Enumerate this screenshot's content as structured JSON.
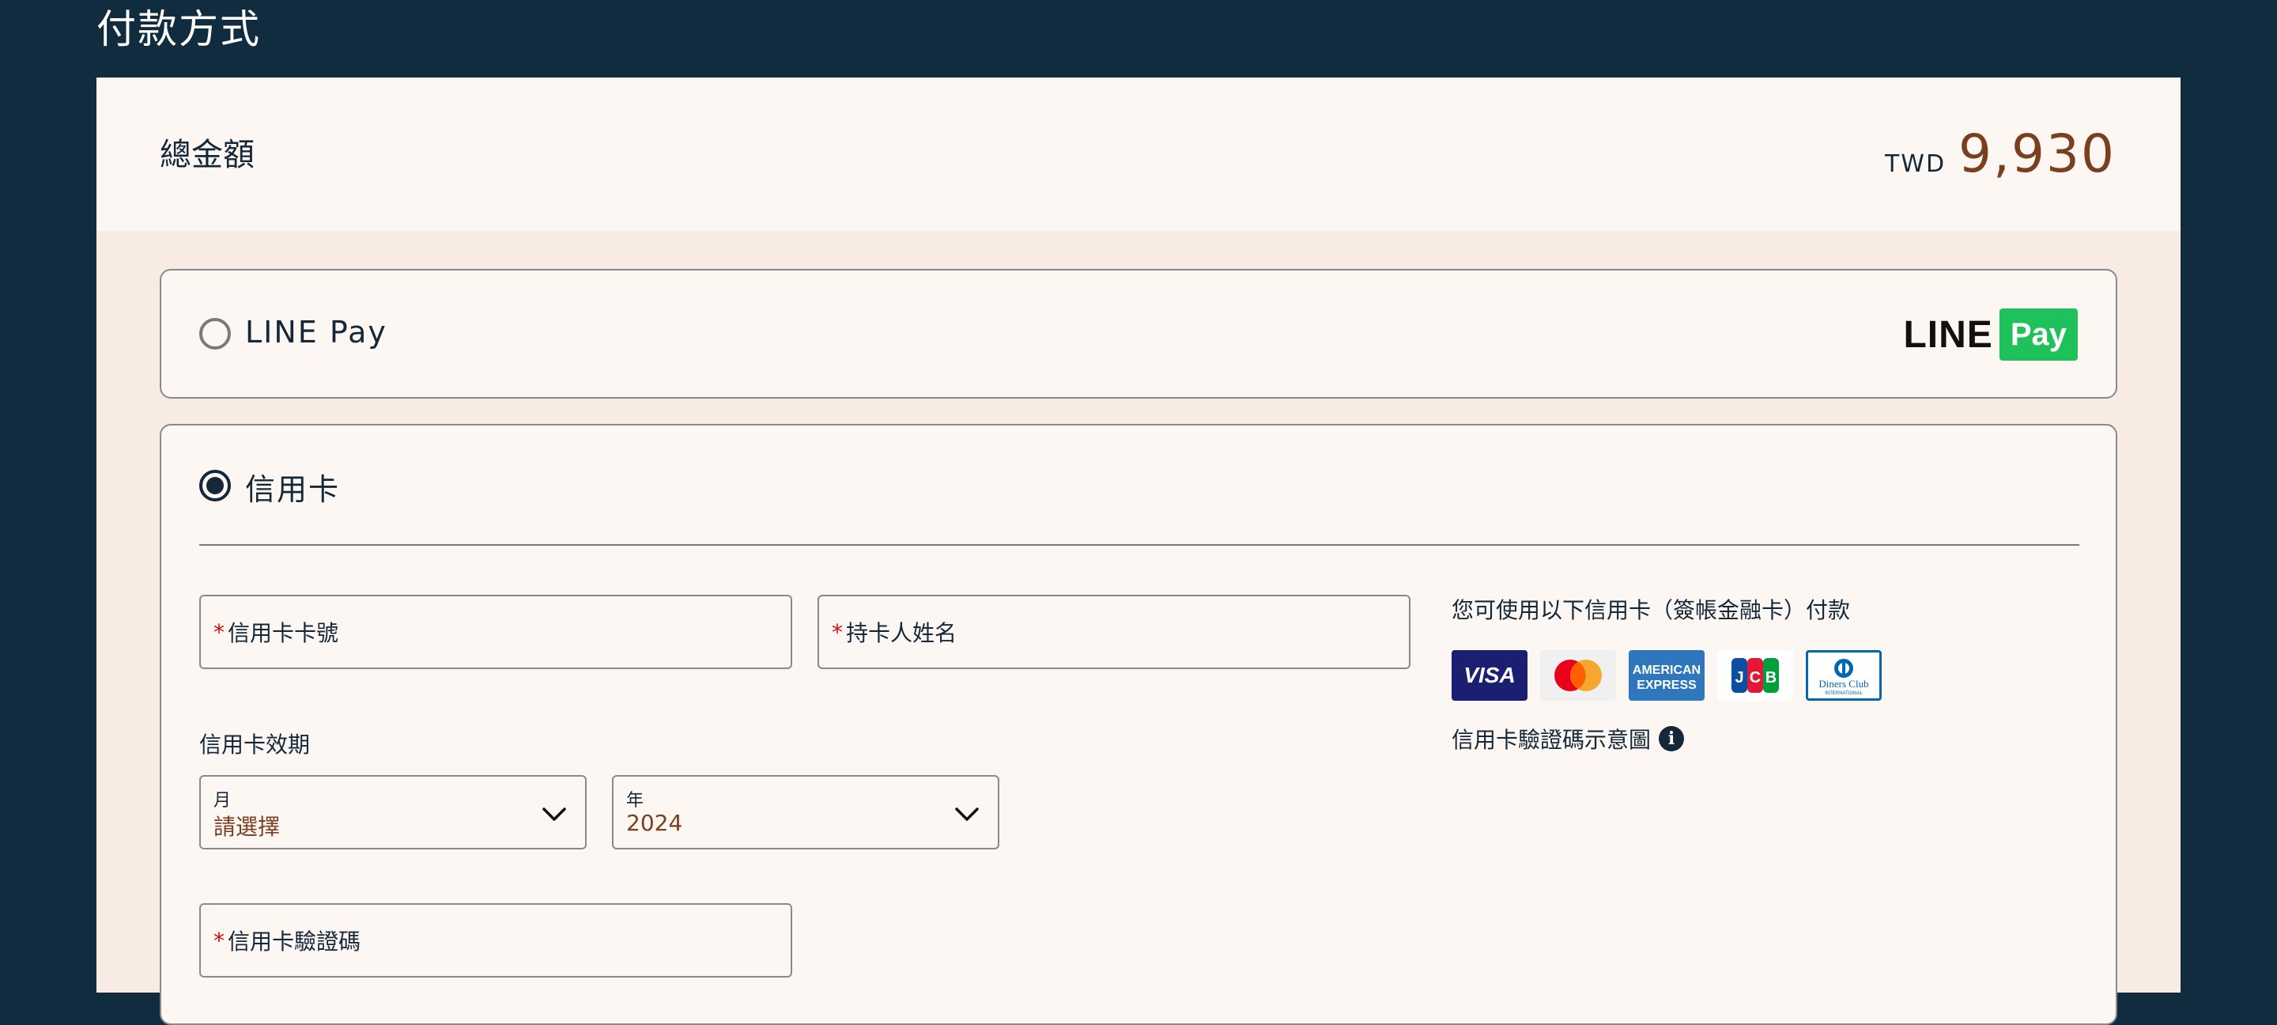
{
  "page": {
    "title": "付款方式"
  },
  "summary": {
    "total_label": "總金額",
    "currency": "TWD",
    "amount": "9,930"
  },
  "payment_options": {
    "line_pay": {
      "label": "LINE Pay",
      "selected": false,
      "logo": {
        "line_text": "LINE",
        "pay_text": "Pay",
        "pay_color": "#1fc15a"
      }
    },
    "credit_card": {
      "label": "信用卡",
      "selected": true
    }
  },
  "form": {
    "card_number": {
      "required_mark": "*",
      "label": "信用卡卡號",
      "value": ""
    },
    "cardholder_name": {
      "required_mark": "*",
      "label": "持卡人姓名",
      "value": ""
    },
    "expiry": {
      "label": "信用卡效期",
      "month": {
        "label": "月",
        "value": "請選擇"
      },
      "year": {
        "label": "年",
        "value": "2024"
      }
    },
    "cvv": {
      "required_mark": "*",
      "label": "信用卡驗證碼",
      "value": ""
    }
  },
  "accepted_cards": {
    "text": "您可使用以下信用卡（簽帳金融卡）付款",
    "cards": [
      {
        "name": "VISA",
        "icon": "visa-logo-icon",
        "bg": "#1a1f71"
      },
      {
        "name": "Mastercard",
        "icon": "mastercard-logo-icon",
        "bg": "#f0f0f0"
      },
      {
        "name": "American Express",
        "icon": "amex-logo-icon",
        "bg": "#2e77bc"
      },
      {
        "name": "JCB",
        "icon": "jcb-logo-icon",
        "bg": "#ffffff"
      },
      {
        "name": "Diners Club",
        "icon": "diners-club-logo-icon",
        "bg": "#ffffff"
      }
    ],
    "cvv_hint": "信用卡驗證碼示意圖",
    "cvv_hint_icon": "info-icon"
  },
  "colors": {
    "background": "#112c3e",
    "panel": "#f7ebe4",
    "card_bg": "#fdf7f3",
    "text": "#14283a",
    "accent": "#7a3f1f",
    "required": "#d10d0d"
  }
}
